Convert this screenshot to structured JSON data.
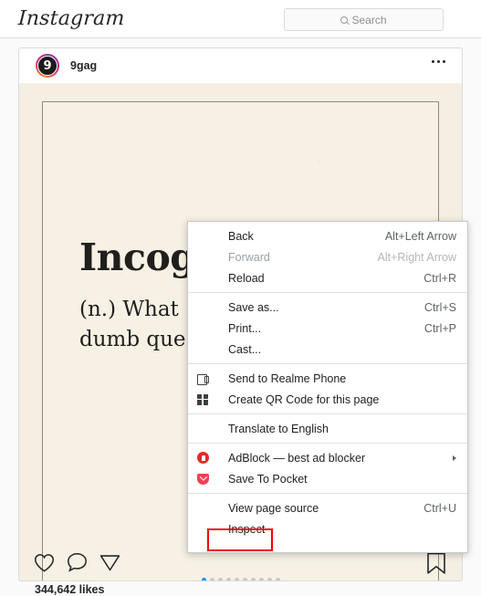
{
  "topnav": {
    "logo": "Instagram",
    "search": {
      "placeholder": "Search",
      "value": "",
      "icon": "search-icon"
    }
  },
  "post": {
    "username": "9gag",
    "avatar_letter": "9",
    "more_label": "•••",
    "media": {
      "title": "Incog",
      "definition_line1": "(n.) What",
      "definition_abbr": "n.",
      "definition_line2": "dumb que"
    },
    "carousel": {
      "count": 10,
      "active_index": 0
    },
    "actions": {
      "like": "like-icon",
      "comment": "comment-icon",
      "share": "share-icon",
      "save": "bookmark-icon"
    },
    "likes_text": "344,642 likes"
  },
  "context_menu": {
    "groups": [
      {
        "items": [
          {
            "label": "Back",
            "accelerator": "Alt+Left Arrow",
            "disabled": false,
            "icon": null
          },
          {
            "label": "Forward",
            "accelerator": "Alt+Right Arrow",
            "disabled": true,
            "icon": null
          },
          {
            "label": "Reload",
            "accelerator": "Ctrl+R",
            "disabled": false,
            "icon": null
          }
        ]
      },
      {
        "items": [
          {
            "label": "Save as...",
            "accelerator": "Ctrl+S",
            "disabled": false,
            "icon": null
          },
          {
            "label": "Print...",
            "accelerator": "Ctrl+P",
            "disabled": false,
            "icon": null
          },
          {
            "label": "Cast...",
            "accelerator": "",
            "disabled": false,
            "icon": null
          }
        ]
      },
      {
        "items": [
          {
            "label": "Send to Realme Phone",
            "accelerator": "",
            "disabled": false,
            "icon": "cast-device-icon"
          },
          {
            "label": "Create QR Code for this page",
            "accelerator": "",
            "disabled": false,
            "icon": "qr-code-icon"
          }
        ]
      },
      {
        "items": [
          {
            "label": "Translate to English",
            "accelerator": "",
            "disabled": false,
            "icon": null
          }
        ]
      },
      {
        "items": [
          {
            "label": "AdBlock — best ad blocker",
            "accelerator": "",
            "disabled": false,
            "icon": "adblock-icon",
            "submenu": true
          },
          {
            "label": "Save To Pocket",
            "accelerator": "",
            "disabled": false,
            "icon": "pocket-icon"
          }
        ]
      },
      {
        "items": [
          {
            "label": "View page source",
            "accelerator": "Ctrl+U",
            "disabled": false,
            "icon": null
          },
          {
            "label": "Inspect",
            "accelerator": "",
            "disabled": false,
            "icon": null,
            "highlighted": true
          }
        ]
      }
    ]
  },
  "colors": {
    "accent": "#0095f6",
    "highlight": "#f40000",
    "page_bg": "#fafafa",
    "border": "#dbdbdb",
    "text": "#262626",
    "muted": "#8e8e8e",
    "paper": "#f6f1e4"
  }
}
